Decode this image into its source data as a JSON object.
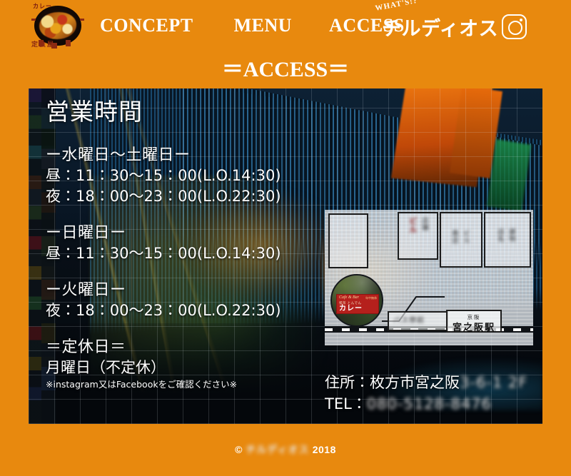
{
  "header": {
    "logo": {
      "name": "curry-logo",
      "text_top": "カレー",
      "text_bottom": "定食屋"
    },
    "nav": [
      {
        "label": "CONCEPT"
      },
      {
        "label": "MENU"
      },
      {
        "label": "ACCESS"
      }
    ],
    "brand": {
      "tagline": "WHAT'S!?",
      "name": "チルディオス"
    },
    "instagram_icon": "instagram-icon"
  },
  "page": {
    "title": "＝ACCESS＝"
  },
  "hours": {
    "title": "営業時間",
    "blocks": [
      {
        "day": "ー水曜日〜土曜日ー",
        "line1": "昼：11：30〜15：00(L.O.14:30)",
        "line2": "夜：18：00〜23：00(L.O.22:30)"
      },
      {
        "day": "ー日曜日ー",
        "line1": "昼：11：30〜15：00(L.O.14:30)",
        "line2": ""
      },
      {
        "day": "ー火曜日ー",
        "line1": "夜：18：00〜23：00(L.O.22:30)",
        "line2": ""
      }
    ],
    "closed": {
      "title": "＝定休日＝",
      "day": "月曜日（不定休）",
      "note": "※instagram又はFacebookをご確認ください※"
    }
  },
  "address": {
    "label": "住所：枚方市宮之阪",
    "redacted_address": "3-6-1  2F",
    "tel_label": "TEL：",
    "redacted_tel": "080-5128-8476"
  },
  "map": {
    "station_sub": "京阪",
    "station_main": "宮之阪駅",
    "shop_sign": {
      "line1": "Cafe & Bar",
      "line2": "喫茶 とんでん",
      "line3": "カレー",
      "line4": "年中無休"
    },
    "redacted_labels": [
      "ビル",
      "店舗",
      "商店",
      "ビル",
      "店名",
      "建物",
      "ショップ"
    ],
    "redacted_small_label": "バス停前"
  },
  "footer": {
    "copyright_mark": "©",
    "redacted_owner": "チルディオス",
    "year": "2018"
  }
}
